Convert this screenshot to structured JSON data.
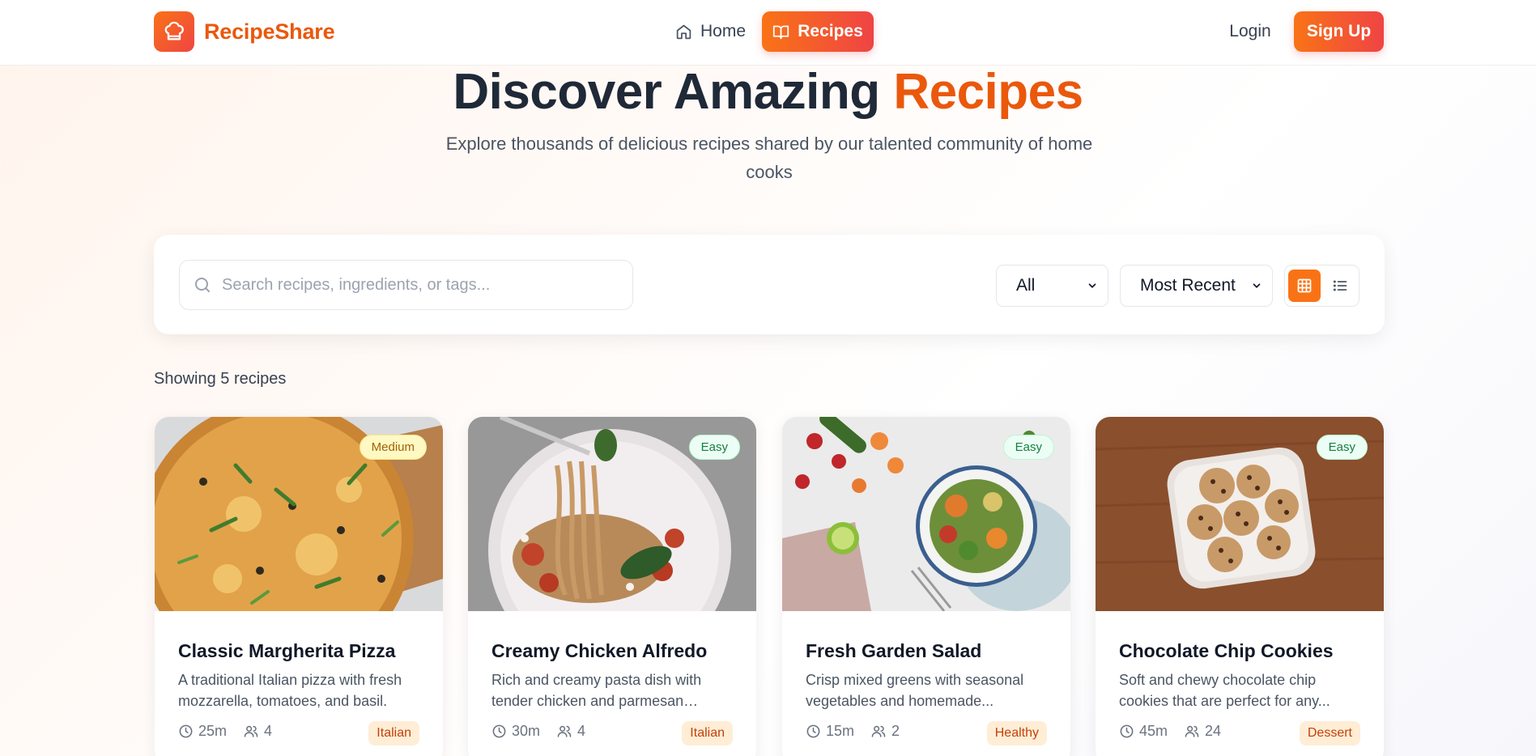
{
  "brand": {
    "name": "RecipeShare",
    "logo_icon": "chef-hat-icon",
    "accent": "#ea580c",
    "gradient": [
      "#f97316",
      "#ef4444"
    ]
  },
  "nav": {
    "home_label": "Home",
    "recipes_label": "Recipes",
    "login_label": "Login",
    "signup_label": "Sign Up"
  },
  "hero": {
    "title_part1": "Discover Amazing ",
    "title_part2": "Recipes",
    "subtitle": "Explore thousands of delicious recipes shared by our talented community of home cooks"
  },
  "filters": {
    "search_placeholder": "Search recipes, ingredients, or tags...",
    "search_value": "",
    "category_selected": "All",
    "sort_selected": "Most Recent",
    "view_mode": "grid"
  },
  "results": {
    "showing_text": "Showing 5 recipes"
  },
  "recipes": [
    {
      "title": "Classic Margherita Pizza",
      "description": "A traditional Italian pizza with fresh mozzarella, tomatoes, and basil.",
      "difficulty": "Medium",
      "time": "25m",
      "servings": "4",
      "cuisine": "Italian",
      "image": "pizza-photo"
    },
    {
      "title": "Creamy Chicken Alfredo",
      "description": "Rich and creamy pasta dish with tender chicken and parmesan cheese.",
      "difficulty": "Easy",
      "time": "30m",
      "servings": "4",
      "cuisine": "Italian",
      "image": "pasta-photo"
    },
    {
      "title": "Fresh Garden Salad",
      "description": "Crisp mixed greens with seasonal vegetables and homemade...",
      "difficulty": "Easy",
      "time": "15m",
      "servings": "2",
      "cuisine": "Healthy",
      "image": "salad-photo"
    },
    {
      "title": "Chocolate Chip Cookies",
      "description": "Soft and chewy chocolate chip cookies that are perfect for any...",
      "difficulty": "Easy",
      "time": "45m",
      "servings": "24",
      "cuisine": "Dessert",
      "image": "cookies-photo"
    }
  ]
}
